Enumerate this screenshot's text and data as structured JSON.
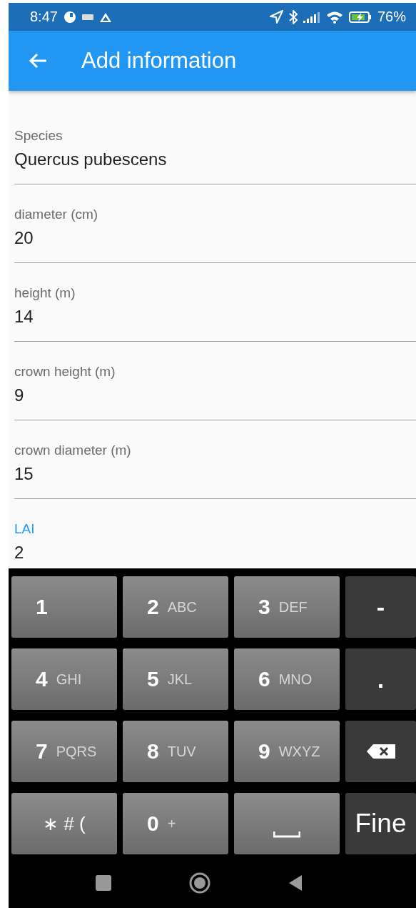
{
  "status_bar": {
    "time": "8:47",
    "battery": "76%"
  },
  "app_bar": {
    "title": "Add information"
  },
  "fields": [
    {
      "label": "Species",
      "value": "Quercus pubescens",
      "focused": false
    },
    {
      "label": "diameter (cm)",
      "value": "20",
      "focused": false
    },
    {
      "label": "height (m)",
      "value": "14",
      "focused": false
    },
    {
      "label": "crown height (m)",
      "value": "9",
      "focused": false
    },
    {
      "label": "crown diameter (m)",
      "value": "15",
      "focused": false
    },
    {
      "label": "LAI",
      "value": "2",
      "focused": true
    }
  ],
  "keyboard": {
    "keys": [
      {
        "kind": "digit",
        "main": "1"
      },
      {
        "kind": "digit",
        "main": "2",
        "sub": "ABC"
      },
      {
        "kind": "digit",
        "main": "3",
        "sub": "DEF"
      },
      {
        "kind": "symbol",
        "main": "-"
      },
      {
        "kind": "digit",
        "main": "4",
        "sub": "GHI"
      },
      {
        "kind": "digit",
        "main": "5",
        "sub": "JKL"
      },
      {
        "kind": "digit",
        "main": "6",
        "sub": "MNO"
      },
      {
        "kind": "symbol",
        "main": "."
      },
      {
        "kind": "digit",
        "main": "7",
        "sub": "PQRS"
      },
      {
        "kind": "digit",
        "main": "8",
        "sub": "TUV"
      },
      {
        "kind": "digit",
        "main": "9",
        "sub": "WXYZ"
      },
      {
        "kind": "backspace"
      },
      {
        "kind": "plain",
        "main": "∗ # ("
      },
      {
        "kind": "digit",
        "main": "0",
        "sub": "+"
      },
      {
        "kind": "space"
      },
      {
        "kind": "action",
        "main": "Fine"
      }
    ]
  }
}
